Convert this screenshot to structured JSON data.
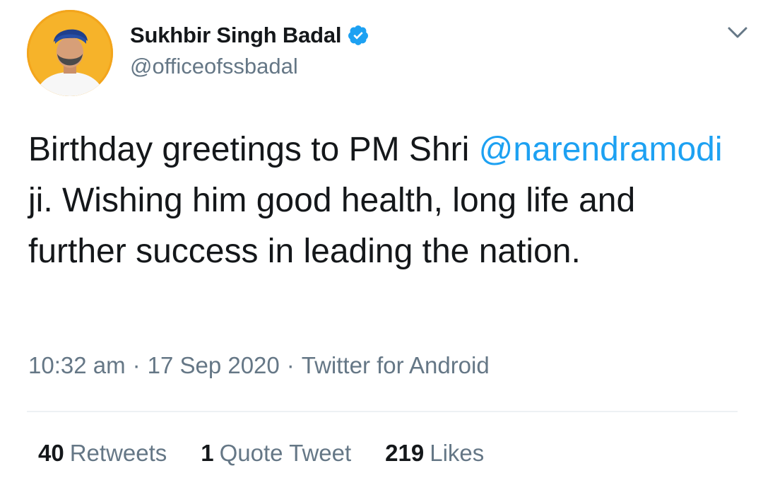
{
  "tweet": {
    "author": {
      "display_name": "Sukhbir Singh Badal",
      "handle": "@officeofssbadal",
      "avatar_icon": "profile-photo",
      "verified_icon": "verified-badge-icon",
      "verified_color": "#1da1f2"
    },
    "menu_icon": "chevron-down-icon",
    "text": {
      "before_mention": "Birthday greetings to PM Shri ",
      "mention": "@narendramodi",
      "after_mention": " ji. Wishing him good health, long life and further success in leading the nation."
    },
    "meta": {
      "time": "10:32 am",
      "date": "17 Sep 2020",
      "source": "Twitter for Android",
      "separator": "·"
    },
    "stats": {
      "retweets_count": "40",
      "retweets_label": "Retweets",
      "quotes_count": "1",
      "quotes_label": "Quote Tweet",
      "likes_count": "219",
      "likes_label": "Likes"
    }
  },
  "colors": {
    "link": "#1da1f2",
    "text_primary": "#14171a",
    "text_secondary": "#657786",
    "avatar_background": "#f3a51c"
  }
}
